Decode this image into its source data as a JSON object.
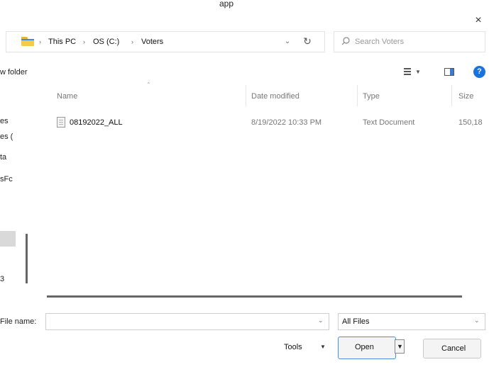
{
  "window": {
    "title_fragment": "app",
    "close_glyph": "×"
  },
  "address_bar": {
    "breadcrumbs": [
      {
        "label": "This PC"
      },
      {
        "label": "OS (C:)"
      },
      {
        "label": "Voters"
      }
    ],
    "separator": "›",
    "dropdown_glyph": "⌄",
    "refresh_glyph": "↻"
  },
  "search": {
    "placeholder": "Search Voters"
  },
  "toolbar": {
    "new_folder_label": "w folder"
  },
  "nav_pane": {
    "items": [
      {
        "label": "es"
      },
      {
        "label": "es ("
      },
      {
        "label": "ta"
      },
      {
        "label": "sFc"
      },
      {
        "label": "3"
      }
    ]
  },
  "file_list": {
    "columns": {
      "name": "Name",
      "date_modified": "Date modified",
      "type": "Type",
      "size": "Size"
    },
    "rows": [
      {
        "name": "08192022_ALL",
        "date_modified": "8/19/2022 10:33 PM",
        "type": "Text Document",
        "size": "150,18"
      }
    ]
  },
  "footer": {
    "filename_label": "File name:",
    "filename_value": "",
    "filetype_value": "All Files",
    "tools_label": "Tools",
    "open_label": "Open",
    "cancel_label": "Cancel"
  },
  "icons": {
    "address": "folder-icon",
    "search": "search-icon",
    "view": "view-menu-icon",
    "pane": "preview-pane-icon",
    "help": "help-icon",
    "file": "text-file-icon"
  },
  "colors": {
    "accent": "#1a73d9",
    "open_border": "#4a8fd9",
    "folder": "#f7c948"
  }
}
